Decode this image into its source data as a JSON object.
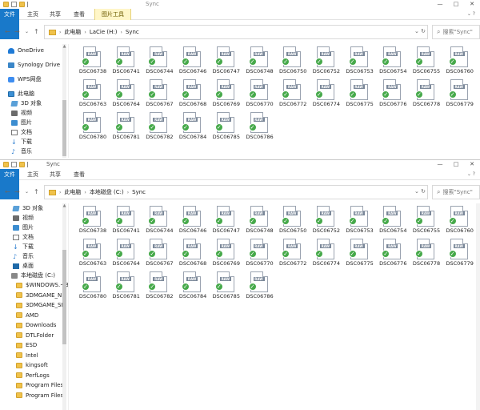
{
  "window1": {
    "title": "Sync",
    "tabs": [
      "文件",
      "主页",
      "共享",
      "查看",
      "图片工具"
    ],
    "context_header": "管理",
    "path": [
      "此电脑",
      "LaCie (H:)",
      "Sync"
    ],
    "search_placeholder": "搜索\"Sync\"",
    "nav": [
      {
        "label": "OneDrive",
        "icon": "cloud-icon"
      },
      {
        "label": "Synology Drive",
        "icon": "synology-icon"
      },
      {
        "label": "WPS网盘",
        "icon": "wps-cloud-icon"
      },
      {
        "label": "此电脑",
        "icon": "computer-icon"
      },
      {
        "label": "3D 对象",
        "icon": "3d-objects-icon"
      },
      {
        "label": "视频",
        "icon": "video-icon"
      },
      {
        "label": "图片",
        "icon": "pictures-icon"
      },
      {
        "label": "文档",
        "icon": "documents-icon"
      },
      {
        "label": "下载",
        "icon": "downloads-icon"
      },
      {
        "label": "音乐",
        "icon": "music-icon"
      }
    ]
  },
  "window2": {
    "title": "Sync",
    "tabs": [
      "文件",
      "主页",
      "共享",
      "查看"
    ],
    "path": [
      "此电脑",
      "本地磁盘 (C:)",
      "Sync"
    ],
    "search_placeholder": "搜索\"Sync\"",
    "nav": [
      {
        "label": "3D 对象",
        "icon": "3d-objects-icon"
      },
      {
        "label": "视频",
        "icon": "video-icon"
      },
      {
        "label": "图片",
        "icon": "pictures-icon"
      },
      {
        "label": "文档",
        "icon": "documents-icon"
      },
      {
        "label": "下载",
        "icon": "downloads-icon"
      },
      {
        "label": "音乐",
        "icon": "music-icon"
      },
      {
        "label": "桌面",
        "icon": "desktop-icon"
      },
      {
        "label": "本地磁盘 (C:)",
        "icon": "drive-icon"
      },
      {
        "label": "$WINDOWS.~BT",
        "icon": "folder-icon"
      },
      {
        "label": "3DMGAME_N",
        "icon": "folder-icon"
      },
      {
        "label": "3DMGAME_SI",
        "icon": "folder-icon"
      },
      {
        "label": "AMD",
        "icon": "folder-icon"
      },
      {
        "label": "Downloads",
        "icon": "folder-icon"
      },
      {
        "label": "DTLFolder",
        "icon": "folder-icon"
      },
      {
        "label": "ESD",
        "icon": "folder-icon"
      },
      {
        "label": "Intel",
        "icon": "folder-icon"
      },
      {
        "label": "kingsoft",
        "icon": "folder-icon"
      },
      {
        "label": "PerfLogs",
        "icon": "folder-icon"
      },
      {
        "label": "Program Files",
        "icon": "folder-icon"
      },
      {
        "label": "Program Files",
        "icon": "folder-icon"
      }
    ]
  },
  "file_badge": "RAW",
  "files": [
    "DSC06738",
    "DSC06741",
    "DSC06744",
    "DSC06746",
    "DSC06747",
    "DSC06748",
    "DSC06750",
    "DSC06752",
    "DSC06753",
    "DSC06754",
    "DSC06755",
    "DSC06760",
    "DSC06763",
    "DSC06764",
    "DSC06767",
    "DSC06768",
    "DSC06769",
    "DSC06770",
    "DSC06772",
    "DSC06774",
    "DSC06775",
    "DSC06776",
    "DSC06778",
    "DSC06779",
    "DSC06780",
    "DSC06781",
    "DSC06782",
    "DSC06784",
    "DSC06785",
    "DSC06786"
  ]
}
